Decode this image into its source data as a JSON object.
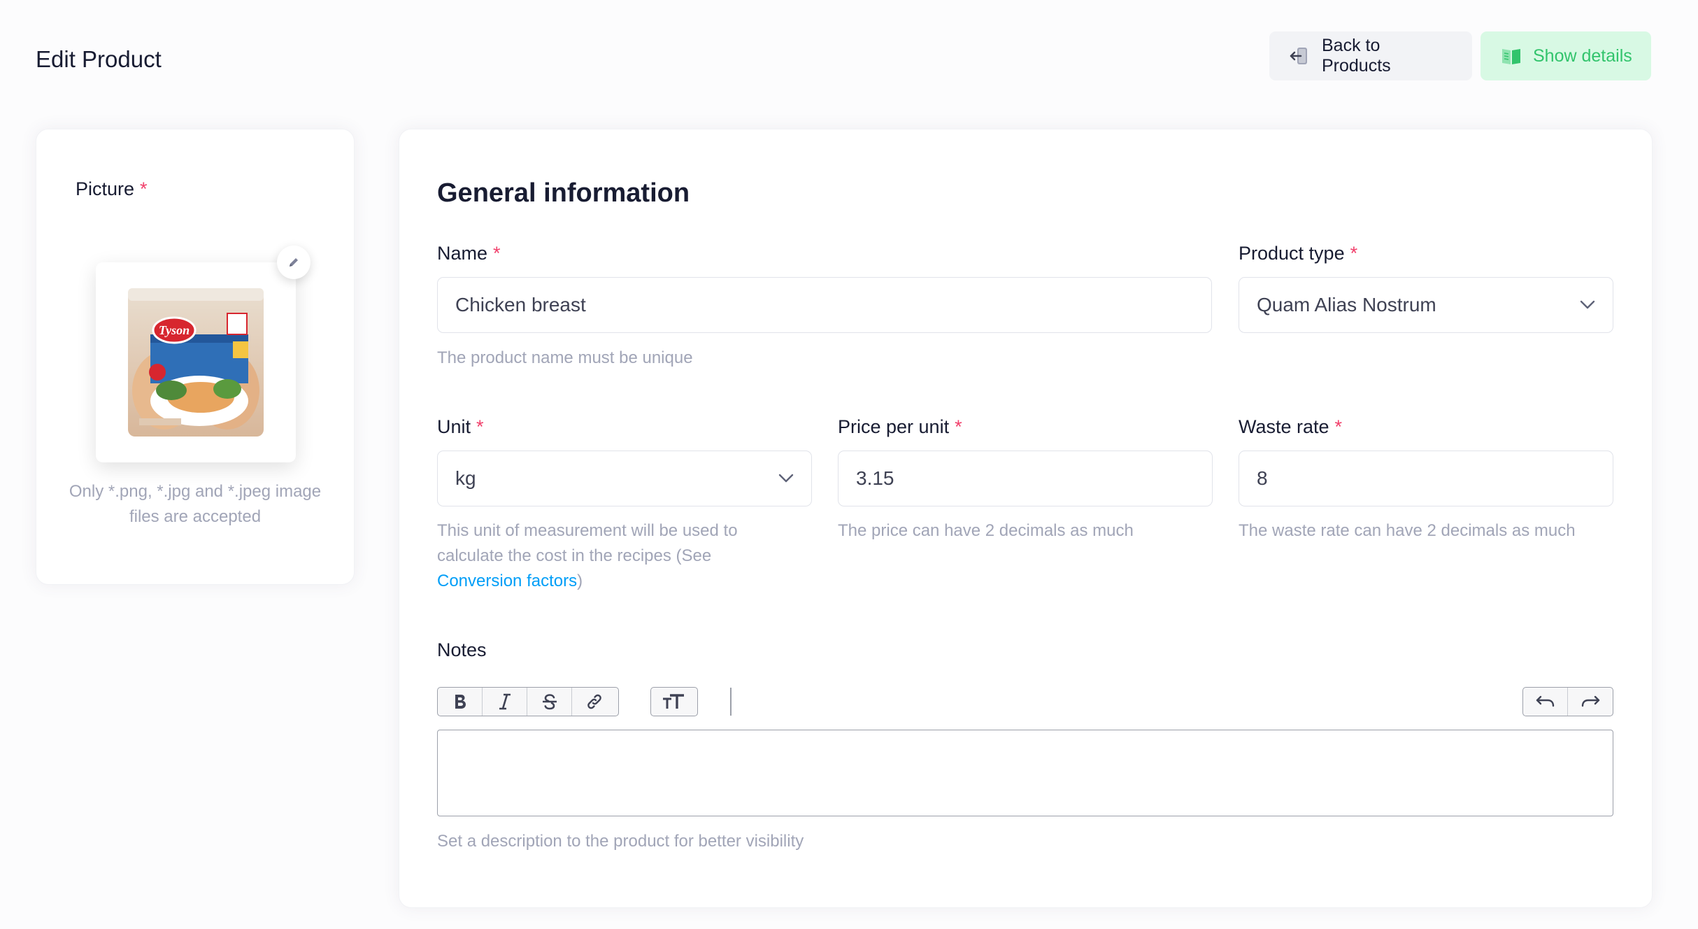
{
  "page": {
    "title": "Edit Product",
    "back_button": "Back to Products",
    "details_button": "Show details"
  },
  "picture": {
    "label": "Picture",
    "required_mark": "*",
    "hint": "Only *.png, *.jpg and *.jpeg image files are accepted",
    "image_alt": "Tyson boneless skinless chicken breasts package",
    "image_brand_text": "Tyson"
  },
  "general": {
    "title": "General information",
    "name": {
      "label": "Name",
      "required_mark": "*",
      "value": "Chicken breast",
      "hint": "The product name must be unique"
    },
    "product_type": {
      "label": "Product type",
      "required_mark": "*",
      "value": "Quam Alias Nostrum"
    },
    "unit": {
      "label": "Unit",
      "required_mark": "*",
      "value": "kg",
      "hint_before": "This unit of measurement will be used to calculate the cost in the recipes (See ",
      "hint_link": "Conversion factors",
      "hint_after": ")"
    },
    "price": {
      "label": "Price per unit",
      "required_mark": "*",
      "value": "3.15",
      "hint": "The price can have 2 decimals as much"
    },
    "waste": {
      "label": "Waste rate",
      "required_mark": "*",
      "value": "8",
      "hint": "The waste rate can have 2 decimals as much"
    },
    "notes": {
      "label": "Notes",
      "value": "",
      "hint": "Set a description to the product for better visibility"
    }
  },
  "icons": {
    "back": "arrow-left-door-icon",
    "details": "book-open-icon",
    "edit_picture": "pencil-icon",
    "select_caret": "chevron-down-icon",
    "bold": "bold-icon",
    "italic": "italic-icon",
    "strike": "strikethrough-icon",
    "link": "link-icon",
    "heading": "text-size-icon",
    "undo": "undo-icon",
    "redo": "redo-icon"
  },
  "colors": {
    "required": "#f1416c",
    "link": "#009ef7",
    "details_bg": "#d8f9e4",
    "details_fg": "#32c46c",
    "hint": "#a1a5b7"
  }
}
